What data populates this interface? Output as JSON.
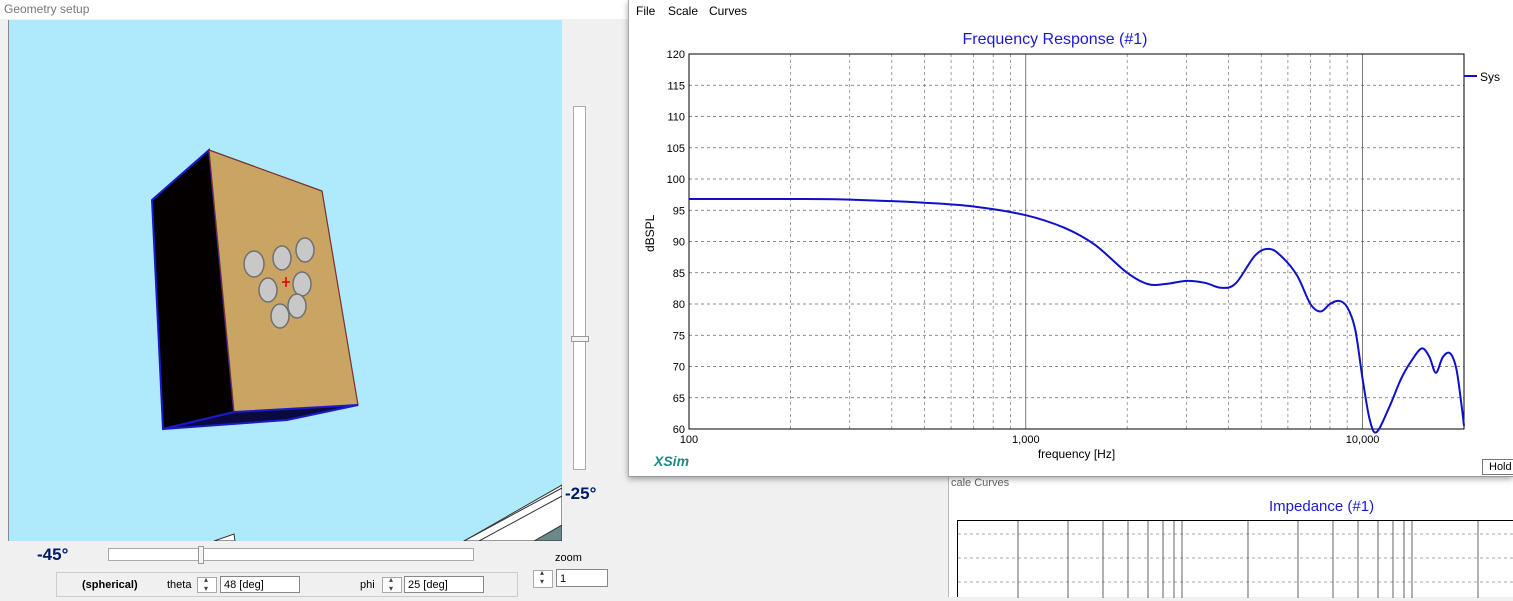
{
  "geometry": {
    "title": "Geometry setup",
    "vertical_angle": "-25°",
    "horizontal_angle": "-45°",
    "zoom_label": "zoom",
    "zoom_value": "1",
    "mode": "(spherical)",
    "theta_label": "theta",
    "theta_value": "48 [deg]",
    "phi_label": "phi",
    "phi_value": "25 [deg]",
    "colors": {
      "background": "#aeeafb",
      "cabinet_front": "#caa463",
      "cabinet_side": "#050000",
      "driver": "#c8c8c8"
    }
  },
  "freq_window": {
    "menu": [
      "File",
      "Scale",
      "Curves"
    ],
    "branding": "XSim",
    "hold_button": "Hold"
  },
  "impedance_window": {
    "menu_text": "cale   Curves",
    "title": "Impedance (#1)"
  },
  "chart_data": {
    "type": "line",
    "title": "Frequency Response (#1)",
    "xlabel": "frequency [Hz]",
    "ylabel": "dBSPL",
    "x_scale": "log",
    "xlim": [
      100,
      20000
    ],
    "ylim": [
      60,
      120
    ],
    "x_ticks": [
      "100",
      "1,000",
      "10,000"
    ],
    "y_ticks": [
      "60",
      "65",
      "70",
      "75",
      "80",
      "85",
      "90",
      "95",
      "100",
      "105",
      "110",
      "115",
      "120"
    ],
    "grid": true,
    "legend_position": "top-right",
    "series": [
      {
        "name": "Sys",
        "color": "#1010cc",
        "x": [
          100,
          200,
          300,
          500,
          700,
          1000,
          1300,
          1600,
          2000,
          2300,
          2600,
          3000,
          3400,
          3800,
          4200,
          4800,
          5300,
          5800,
          6400,
          7000,
          7500,
          8000,
          8500,
          9000,
          9500,
          10000,
          10500,
          11000,
          12000,
          13000,
          14000,
          15000,
          15800,
          16500,
          17300,
          18200,
          19000,
          19700,
          20000
        ],
        "y": [
          96.8,
          96.8,
          96.7,
          96.2,
          95.6,
          94.2,
          92.2,
          89.5,
          85.0,
          83.2,
          83.2,
          83.7,
          83.4,
          82.6,
          83.3,
          87.8,
          88.8,
          87.4,
          84.5,
          80.0,
          78.8,
          80.0,
          80.5,
          79.5,
          76.0,
          68.0,
          61.5,
          59.5,
          63.5,
          68.0,
          71.0,
          72.9,
          71.5,
          69.0,
          71.5,
          72.1,
          69.5,
          63.5,
          60.5
        ]
      }
    ]
  }
}
